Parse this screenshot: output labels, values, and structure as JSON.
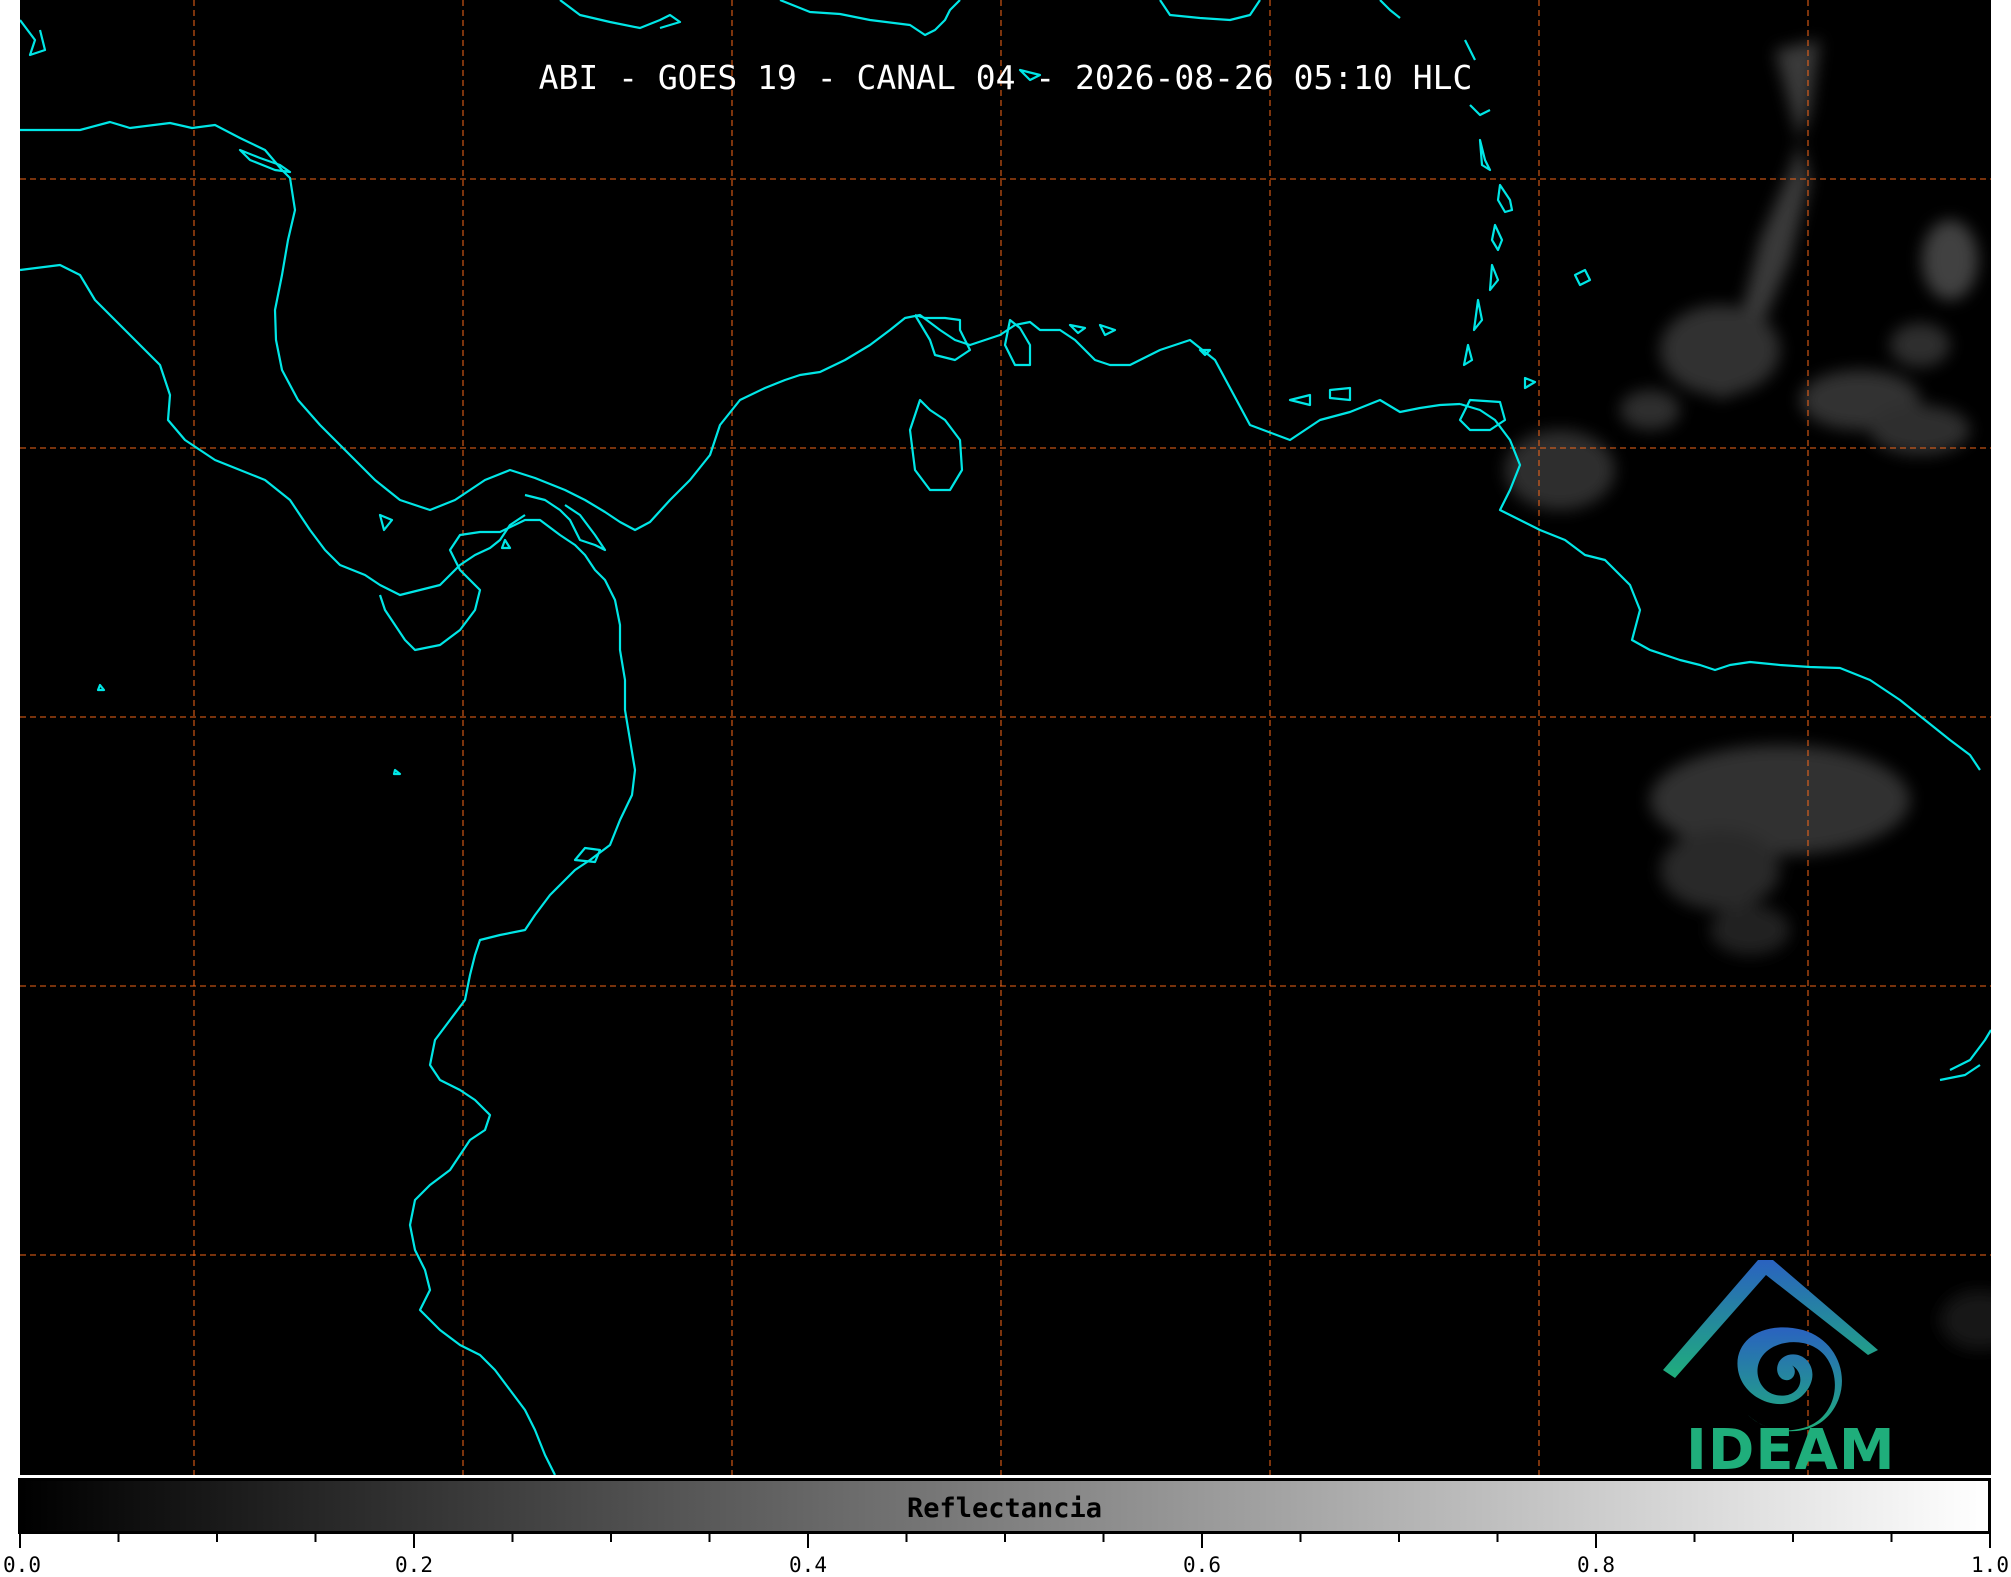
{
  "title": "ABI - GOES 19 - CANAL 04 - 2026-08-26 05:10 HLC",
  "logo": {
    "text": "IDEAM",
    "icon": "ideam-logo-icon"
  },
  "colorbar": {
    "label": "Reflectancia",
    "ticks": [
      "0.0",
      "0.2",
      "0.4",
      "0.6",
      "0.8",
      "1.0"
    ],
    "range": [
      0.0,
      1.0
    ],
    "colormap": [
      "#000000",
      "#ffffff"
    ]
  },
  "map": {
    "gridline_color": "#ff6a1a",
    "coastline_color": "#00ffff",
    "background_color": "#000000"
  }
}
